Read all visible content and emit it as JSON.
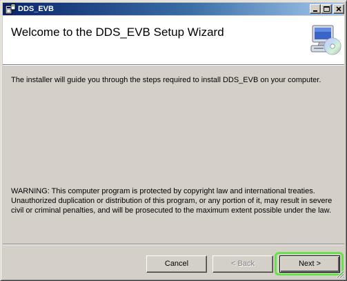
{
  "window": {
    "title": "DDS_EVB"
  },
  "header": {
    "title": "Welcome to the DDS_EVB Setup Wizard",
    "icon": "computer-cd-icon"
  },
  "body": {
    "intro": "The installer will guide you through the steps required to install DDS_EVB on your computer.",
    "warning": "WARNING: This computer program is protected by copyright law and international treaties. Unauthorized duplication or distribution of this program, or any portion of it, may result in severe civil or criminal penalties, and will be prosecuted to the maximum extent possible under the law."
  },
  "buttons": {
    "cancel": "Cancel",
    "back": "< Back",
    "next": "Next >"
  },
  "colors": {
    "highlight": "#66e24a",
    "titlebar_start": "#0a246a",
    "titlebar_end": "#a6caf0",
    "dialog_bg": "#d4d0c8"
  }
}
